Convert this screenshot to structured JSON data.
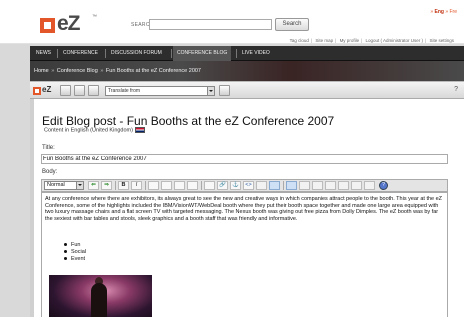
{
  "header": {
    "logo_text": "eZ",
    "logo_tm": "™",
    "search": {
      "label": "SEARCH",
      "value": "",
      "button_label": "Search"
    },
    "lang": {
      "arrow1": "»",
      "eng": "Eng",
      "arrow2": "»",
      "fre": "Fre"
    },
    "links": [
      "Tag cloud",
      "Site map",
      "My profile",
      "Logout ( Administrator User )",
      "Site settings"
    ]
  },
  "nav": {
    "items": [
      {
        "label": "NEWS"
      },
      {
        "label": "CONFERENCE"
      },
      {
        "label": "DISCUSSION FORUM"
      },
      {
        "label": "CONFERENCE BLOG",
        "active": true
      },
      {
        "label": "LIVE VIDEO"
      }
    ]
  },
  "breadcrumb": {
    "home": "Home",
    "blog": "Conference Blog",
    "current": "Fun Booths at the eZ Conference 2007",
    "sep": "»"
  },
  "ez_toolbar": {
    "logo_text": "eZ",
    "translate": "Translate from",
    "help": "?"
  },
  "editor": {
    "page_title": "Edit Blog post - Fun Booths at the eZ Conference 2007",
    "subtitle": "Content in English (United Kingdom)",
    "title_label": "Title:",
    "title_value": "Fun Booths at the eZ Conference 2007",
    "body_label": "Body:",
    "format_select": "Normal",
    "toolbar_glyphs": {
      "bold": "B",
      "italic": "I",
      "undo": "⇐",
      "redo": "⇒",
      "link": "🔗",
      "anchor": "⚓",
      "code": "<>",
      "help": "?"
    },
    "body_text": "At any conference where there are exhibitors, its always great to see the new and creative ways in which companies attract people to the booth. This year at the eZ Conference, some of the highlights included the IBM/VisionWT/WebDeal booth where they put their booth space together and made one large area equipped with two luxury massage chairs and a flat screen TV with targeted messaging. The Nexus booth was giving out free pizza from Dolly Dimples. The eZ booth was by far the sexiest with bar tables and stools, sleek graphics and a booth staff that was friendly and informative.",
    "list": [
      "Fun",
      "Social",
      "Event"
    ]
  },
  "colors": {
    "brand": "#e2562a",
    "nav_bg": "#2d2d2d",
    "active_lang": "#c03010"
  }
}
